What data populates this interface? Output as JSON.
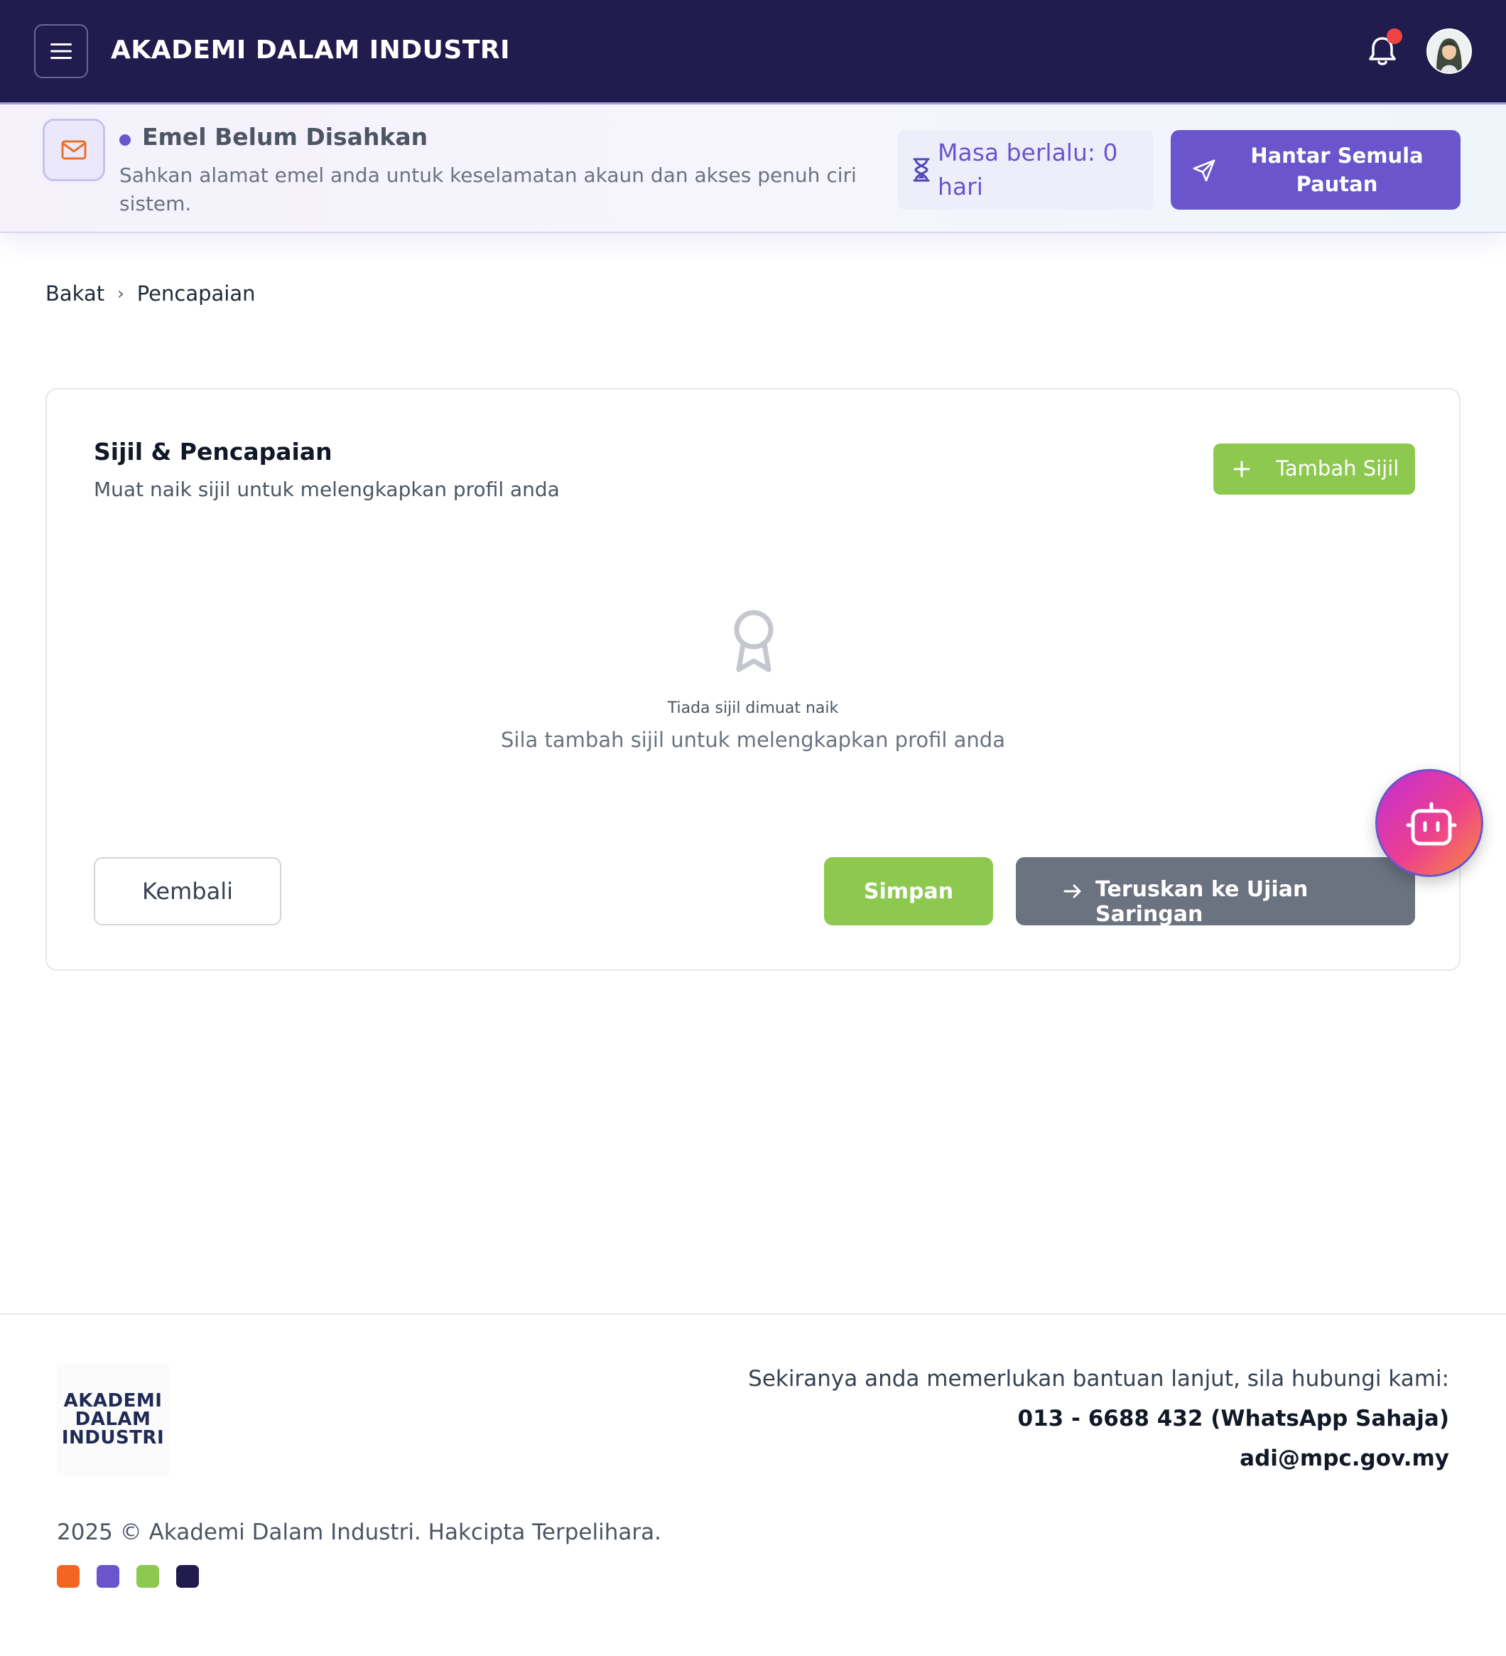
{
  "header": {
    "title": "AKADEMI DALAM INDUSTRI",
    "menu_icon": "hamburger-menu-icon",
    "notification_icon": "bell-icon",
    "has_notification": true
  },
  "verify_banner": {
    "title": "Emel Belum Disahkan",
    "description": "Sahkan alamat emel anda untuk keselamatan akaun dan akses penuh ciri sistem.",
    "expiry": "Masa berlalu: 0 hari",
    "resend_label": "Hantar Semula Pautan",
    "icon": "mail-icon"
  },
  "breadcrumb": {
    "items": [
      "Bakat",
      "Pencapaian"
    ],
    "separator": "›"
  },
  "card": {
    "title": "Sijil & Pencapaian",
    "subtitle": "Muat naik sijil untuk melengkapkan profil anda",
    "add_label": "Tambah Sijil",
    "empty_title": "Tiada sijil dimuat naik",
    "empty_desc": "Sila tambah sijil untuk melengkapkan profil anda",
    "back_label": "Kembali",
    "save_label": "Simpan",
    "continue_label": "Teruskan ke Ujian Saringan"
  },
  "footer": {
    "logo_lines": [
      "AKADEMI",
      "DALAM",
      "INDUSTRI"
    ],
    "help_text": "Sekiranya anda memerlukan bantuan lanjut, sila hubungi kami:",
    "phone": "013 - 6688 432 (WhatsApp Sahaja)",
    "email": "adi@mpc.gov.my",
    "copyright": "2025 © Akademi Dalam Industri. Hakcipta Terpelihara.",
    "brand_colors": [
      "#f26522",
      "#6a55cc",
      "#8dc94f",
      "#211b4e"
    ]
  },
  "colors": {
    "header_bg": "#211b4e",
    "accent": "#6a55cc",
    "success": "#8dc94f",
    "muted_button": "#6b7280",
    "notification_dot": "#ef4444"
  }
}
